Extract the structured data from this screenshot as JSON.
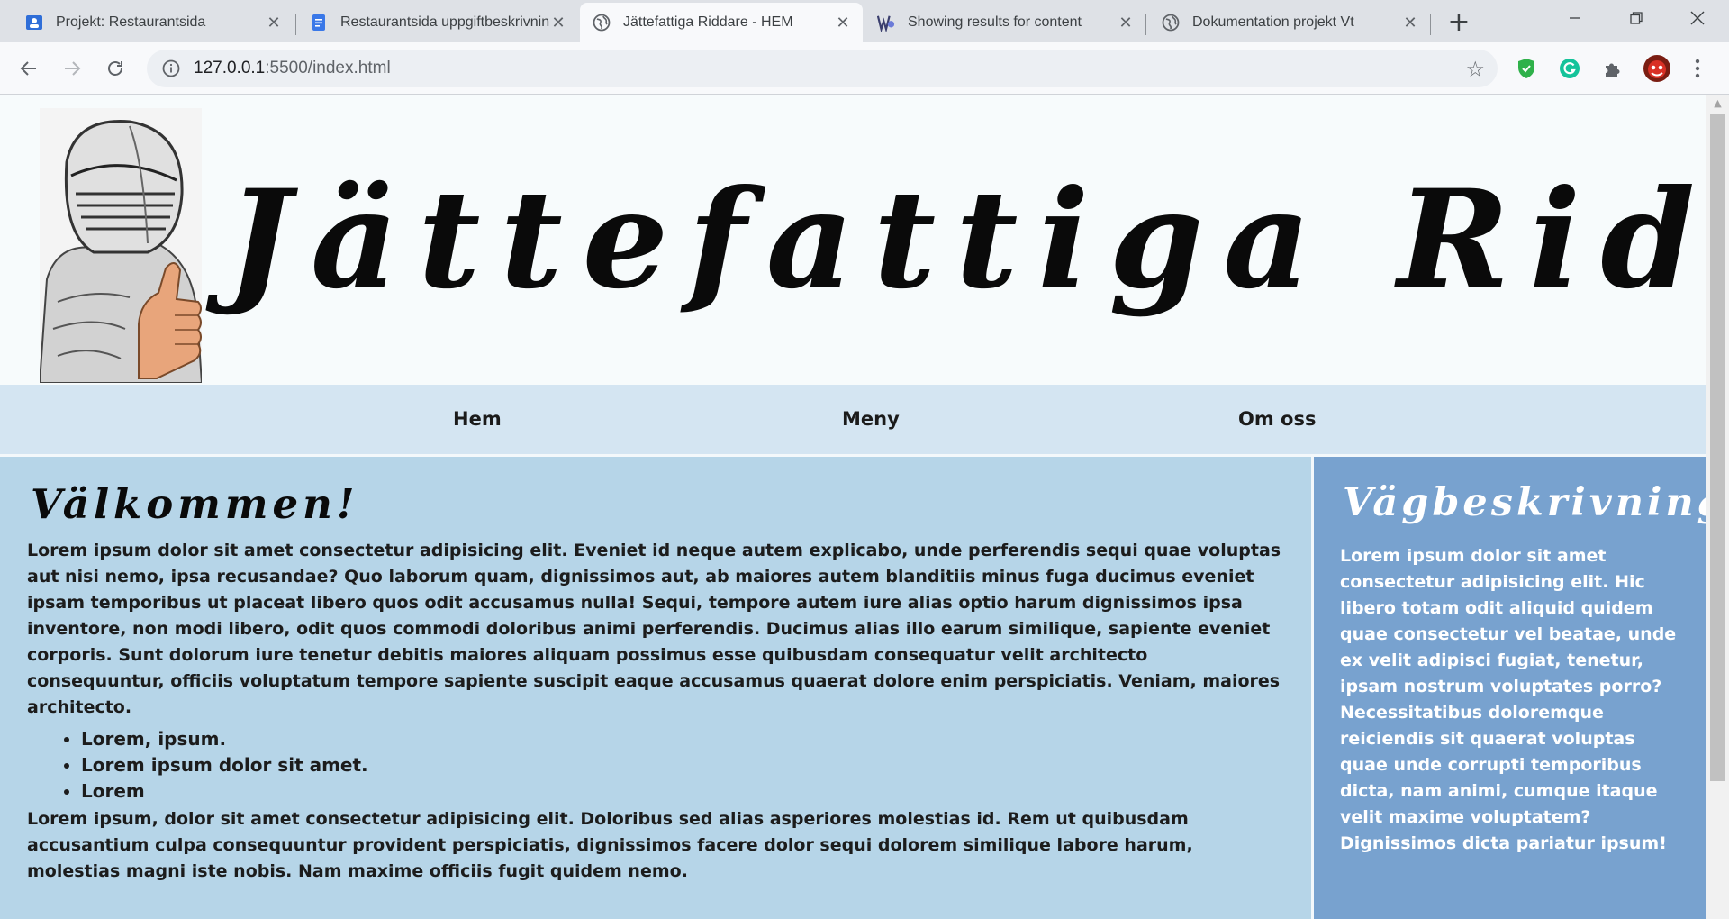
{
  "browser": {
    "tabs": [
      {
        "title": "Projekt: Restaurantsida",
        "icon": "classroom-icon"
      },
      {
        "title": "Restaurantsida uppgiftbeskrivning",
        "icon": "docs-icon"
      },
      {
        "title": "Jättefattiga Riddare - HEM",
        "icon": "globe-icon",
        "active": true
      },
      {
        "title": "Showing results for content",
        "icon": "site-logo-icon"
      },
      {
        "title": "Dokumentation projekt Vt",
        "icon": "globe-icon"
      }
    ],
    "close_glyph": "✕",
    "new_tab_glyph": "+",
    "url_host": "127.0.0.1",
    "url_path": ":5500/index.html",
    "colors": {
      "shield": "#2fb14a",
      "grammarly": "#15c39a",
      "avatar": "#d93025"
    }
  },
  "site": {
    "title": "Jättefattiga Riddare",
    "nav": [
      "Hem",
      "Meny",
      "Om oss"
    ],
    "main": {
      "heading": "Välkommen!",
      "paragraph1": "Lorem ipsum dolor sit amet consectetur adipisicing elit. Eveniet id neque autem explicabo, unde perferendis sequi quae voluptas aut nisi nemo, ipsa recusandae? Quo laborum quam, dignissimos aut, ab maiores autem blanditiis minus fuga ducimus eveniet ipsam temporibus ut placeat libero quos odit accusamus nulla! Sequi, tempore autem iure alias optio harum dignissimos ipsa inventore, non modi libero, odit quos commodi doloribus animi perferendis. Ducimus alias illo earum similique, sapiente eveniet corporis. Sunt dolorum iure tenetur debitis maiores aliquam possimus esse quibusdam consequatur velit architecto consequuntur, officiis voluptatum tempore sapiente suscipit eaque accusamus quaerat dolore enim perspiciatis. Veniam, maiores architecto.",
      "list": [
        "Lorem, ipsum.",
        "Lorem ipsum dolor sit amet.",
        "Lorem"
      ],
      "paragraph2": "Lorem ipsum, dolor sit amet consectetur adipisicing elit. Doloribus sed alias asperiores molestias id. Rem ut quibusdam accusantium culpa consequuntur provident perspiciatis, dignissimos facere dolor sequi dolorem similique labore harum, molestias magni iste nobis. Nam maxime officiis fugit quidem nemo."
    },
    "aside": {
      "heading": "Vägbeskrivning",
      "text": "Lorem ipsum dolor sit amet consectetur adipisicing elit. Hic libero totam odit aliquid quidem quae consectetur vel beatae, unde ex velit adipisci fugiat, tenetur, ipsam nostrum voluptates porro? Necessitatibus doloremque reiciendis sit quaerat voluptas quae unde corrupti temporibus dicta, nam animi, cumque itaque velit maxime voluptatem? Dignissimos dicta pariatur ipsum!"
    }
  }
}
